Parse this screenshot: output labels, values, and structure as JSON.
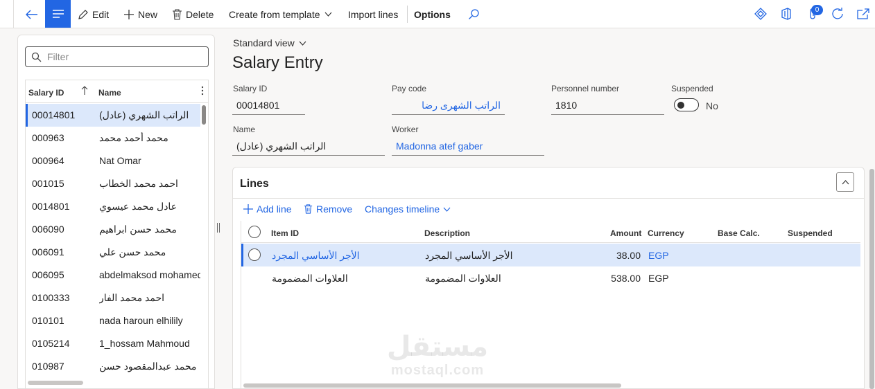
{
  "toolbar": {
    "edit": "Edit",
    "new": "New",
    "delete": "Delete",
    "create_from_template": "Create from template",
    "import_lines": "Import lines",
    "options": "Options",
    "notification_count": "0"
  },
  "left_pane": {
    "filter_placeholder": "Filter",
    "columns": {
      "salary_id": "Salary ID",
      "name": "Name"
    },
    "rows": [
      {
        "id": "00014801",
        "name": "الراتب الشهري (عادل)",
        "selected": true
      },
      {
        "id": "000963",
        "name": "محمد أحمد محمد"
      },
      {
        "id": "000964",
        "name": "Nat Omar"
      },
      {
        "id": "001015",
        "name": "احمد  محمد  الخطاب"
      },
      {
        "id": "0014801",
        "name": "عادل محمد عيسوي"
      },
      {
        "id": "006090",
        "name": "محمد حسن ابراهيم"
      },
      {
        "id": "006091",
        "name": "محمد حسن علي"
      },
      {
        "id": "006095",
        "name": "abdelmaksod mohamed"
      },
      {
        "id": "0100333",
        "name": "احمد محمد الفار"
      },
      {
        "id": "010101",
        "name": "nada  haroun elhilily"
      },
      {
        "id": "0105214",
        "name": "1_hossam Mahmoud"
      },
      {
        "id": "010987",
        "name": "محمد عبدالمقصود حسن"
      }
    ]
  },
  "main": {
    "view_selector": "Standard view",
    "title": "Salary Entry",
    "fields": {
      "salary_id_label": "Salary ID",
      "salary_id": "00014801",
      "pay_code_label": "Pay code",
      "pay_code": "الراتب الشهرى رضا",
      "personnel_number_label": "Personnel number",
      "personnel_number": "1810",
      "suspended_label": "Suspended",
      "suspended_value": "No",
      "name_label": "Name",
      "name": "الراتب الشهري (عادل)",
      "worker_label": "Worker",
      "worker": "Madonna atef gaber"
    }
  },
  "lines": {
    "title": "Lines",
    "add_line": "Add line",
    "remove": "Remove",
    "changes_timeline": "Changes timeline",
    "columns": {
      "item_id": "Item ID",
      "description": "Description",
      "amount": "Amount",
      "currency": "Currency",
      "base_calc": "Base Calc.",
      "suspended": "Suspended"
    },
    "rows": [
      {
        "item_id": "الأجر الأساسي المجرد",
        "description": "الأجر الأساسي المجرد",
        "amount": "38.00",
        "currency": "EGP",
        "selected": true
      },
      {
        "item_id": "العلاوات المضمومة",
        "description": "العلاوات المضمومة",
        "amount": "538.00",
        "currency": "EGP"
      }
    ]
  },
  "watermark": {
    "arabic": "مستقل",
    "latin": "mostaql.com"
  },
  "colors": {
    "accent": "#2266e3",
    "selection": "#dce8fb"
  }
}
